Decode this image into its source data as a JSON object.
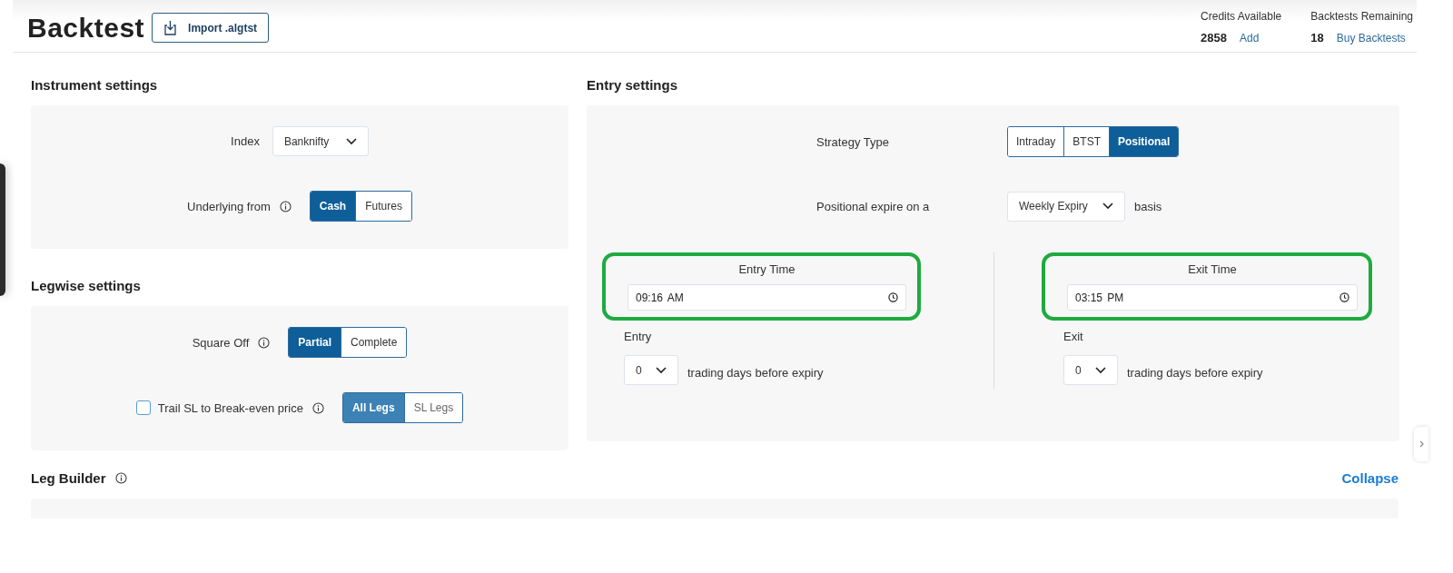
{
  "header": {
    "title": "Backtest",
    "import_button": "Import .algtst",
    "stats": [
      {
        "label": "Credits Available",
        "value": "2858",
        "link": "Add"
      },
      {
        "label": "Backtests Remaining",
        "value": "18",
        "link": "Buy Backtests"
      }
    ]
  },
  "instrument_settings": {
    "title": "Instrument settings",
    "rows": [
      {
        "kind": "dropdown",
        "label": "Index",
        "value": "Banknifty"
      },
      {
        "kind": "segmented",
        "label": "Underlying from",
        "info": true,
        "options": [
          {
            "label": "Cash",
            "selected": true
          },
          {
            "label": "Futures",
            "selected": false
          }
        ]
      }
    ]
  },
  "legwise_settings": {
    "title": "Legwise settings",
    "rows": [
      {
        "kind": "segmented",
        "label": "Square Off",
        "info": true,
        "options": [
          {
            "label": "Partial",
            "selected": true
          },
          {
            "label": "Complete",
            "selected": false
          }
        ]
      },
      {
        "kind": "checkbox_segmented",
        "label": "Trail SL to Break-even price",
        "checked": false,
        "info": true,
        "options": [
          {
            "label": "All Legs",
            "selected": true
          },
          {
            "label": "SL Legs",
            "selected": false
          }
        ]
      }
    ]
  },
  "entry_settings": {
    "title": "Entry settings",
    "strategy_type": {
      "label": "Strategy Type",
      "options": [
        {
          "label": "Intraday",
          "selected": false
        },
        {
          "label": "BTST",
          "selected": false
        },
        {
          "label": "Positional",
          "selected": true
        }
      ]
    },
    "expiry": {
      "label": "Positional expire on a",
      "value": "Weekly Expiry",
      "suffix": "basis"
    },
    "times": [
      {
        "title": "Entry Time",
        "value": "09:16 AM",
        "highlighted": true,
        "days_label": "Entry",
        "days_value": "0",
        "days_suffix": "trading days before expiry"
      },
      {
        "title": "Exit Time",
        "value": "03:15 PM",
        "highlighted": true,
        "days_label": "Exit",
        "days_value": "0",
        "days_suffix": "trading days before expiry"
      }
    ]
  },
  "leg_builder": {
    "title": "Leg Builder",
    "info": true,
    "action": "Collapse"
  }
}
